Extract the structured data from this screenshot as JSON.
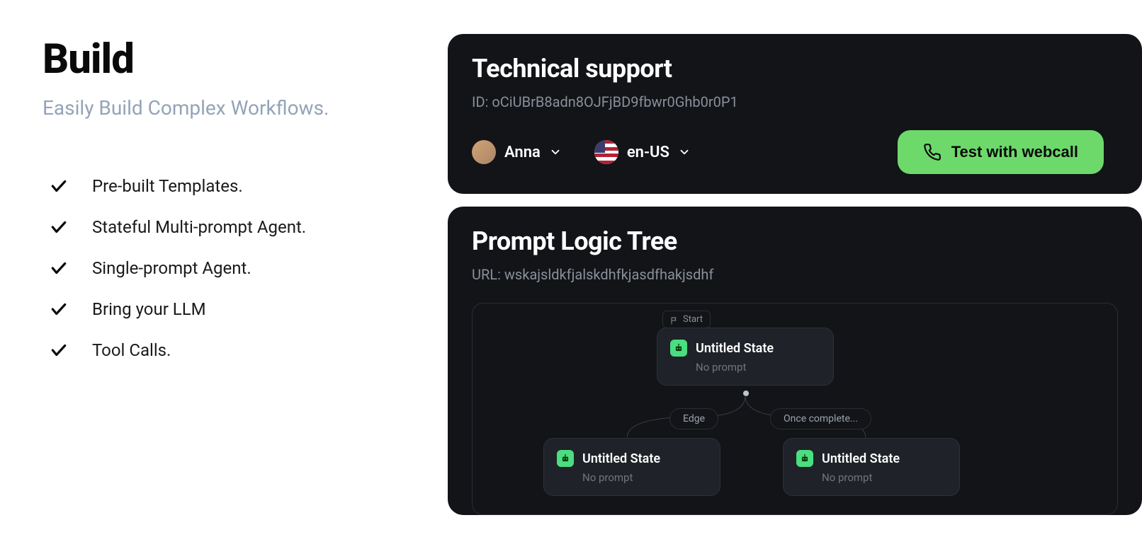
{
  "left": {
    "title": "Build",
    "subtitle": "Easily Build  Complex Workflows.",
    "features": [
      "Pre-built Templates.",
      "Stateful Multi-prompt Agent.",
      "Single-prompt Agent.",
      "Bring your LLM",
      "Tool Calls."
    ]
  },
  "header_card": {
    "title": "Technical support",
    "id_label": "ID: ",
    "id_value": "oCiUBrB8adn8OJFjBD9fbwr0Ghb0r0P1",
    "persona_name": "Anna",
    "locale": "en-US",
    "test_button": "Test with webcall"
  },
  "tree_card": {
    "title": "Prompt Logic Tree",
    "url_label": "URL: ",
    "url_value": "wskajsldkfjalskdhfkjasdfhakjsdhf",
    "start_label": "Start",
    "edge_left_label": "Edge",
    "edge_right_label": "Once complete...",
    "nodes": {
      "root": {
        "title": "Untitled State",
        "sub": "No prompt"
      },
      "left": {
        "title": "Untitled State",
        "sub": "No prompt"
      },
      "right": {
        "title": "Untitled State",
        "sub": "No prompt"
      }
    }
  }
}
